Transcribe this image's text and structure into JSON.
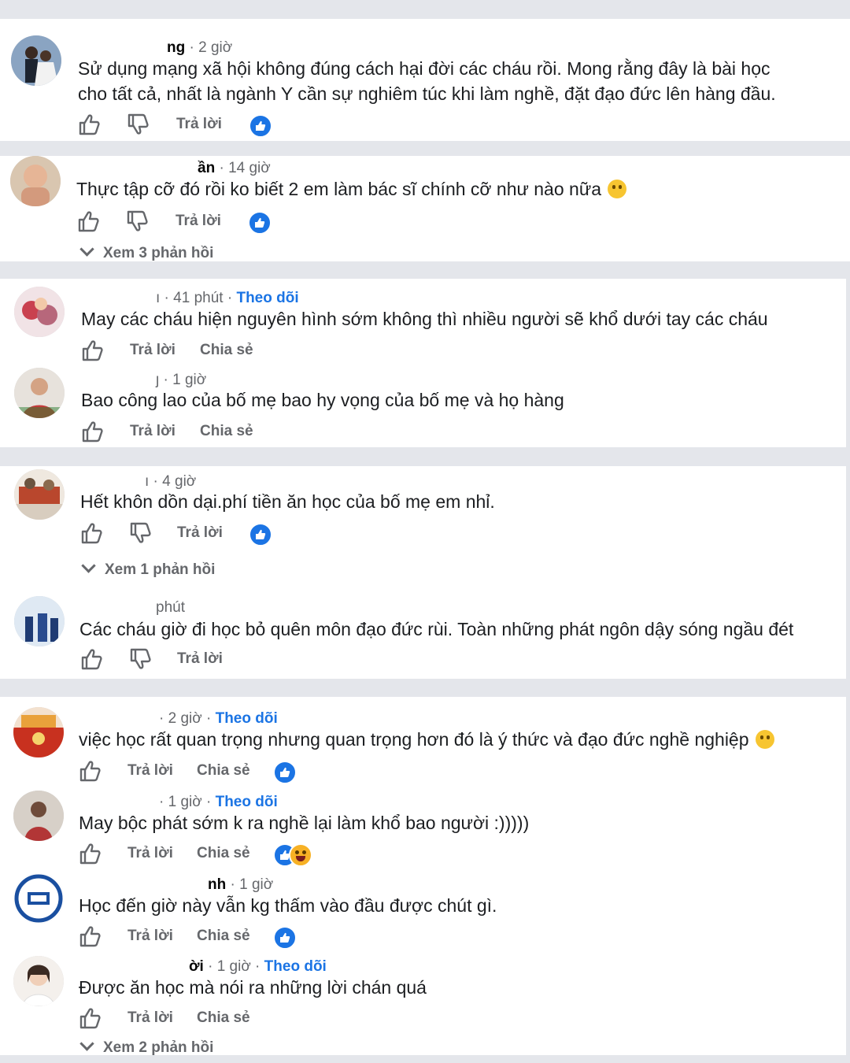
{
  "comments": [
    {
      "name": "ng",
      "time": "2 giờ",
      "follow": "",
      "text": "Sử dụng mạng xã hội không đúng cách hại đời các cháu rồi. Mong rằng đây là bài học cho tất cả, nhất là ngành Y cần sự nghiêm túc khi làm nghề, đặt đạo đức lên hàng đầu.",
      "reply": "Trả lời",
      "share": ""
    },
    {
      "name": "ần",
      "time": "14 giờ",
      "follow": "",
      "text": "Thực tập cỡ đó rồi ko biết 2 em làm bác sĩ chính cỡ như nào nữa",
      "reply": "Trả lời",
      "share": "",
      "more": "Xem 3 phản hồi"
    },
    {
      "name": "",
      "time": "41 phút",
      "follow": "Theo dõi",
      "text": "May các cháu hiện nguyên hình sớm không thì nhiều người sẽ khổ dưới tay các cháu",
      "reply": "Trả lời",
      "share": "Chia sẻ"
    },
    {
      "name": "",
      "time": "1 giờ",
      "follow": "",
      "text": "Bao công lao của bố mẹ bao hy vọng của bố mẹ và họ hàng",
      "reply": "Trả lời",
      "share": "Chia sẻ"
    },
    {
      "name": "",
      "time": "4 giờ",
      "follow": "",
      "text": "Hết khôn dồn dại.phí tiền ăn học của bố mẹ em nhỉ.",
      "reply": "Trả lời",
      "share": "",
      "more": "Xem 1 phản hồi"
    },
    {
      "name": "",
      "time": "phút",
      "follow": "",
      "text": "Các cháu giờ đi học bỏ quên môn đạo đức rùi. Toàn những phát ngôn dậy sóng ngầu đét",
      "reply": "Trả lời",
      "share": ""
    },
    {
      "name": "",
      "time": "2 giờ",
      "follow": "Theo dõi",
      "text": "việc học rất quan trọng nhưng quan trọng hơn đó là ý thức và đạo đức nghề nghiệp",
      "reply": "Trả lời",
      "share": "Chia sẻ"
    },
    {
      "name": "",
      "time": "1 giờ",
      "follow": "Theo dõi",
      "text": "May bộc phát sớm k ra nghề lại làm khổ bao người :)))))",
      "reply": "Trả lời",
      "share": "Chia sẻ"
    },
    {
      "name": "nh",
      "time": "1 giờ",
      "follow": "",
      "text": "Học đến giờ này vẫn kg thấm vào đầu được chút gì.",
      "reply": "Trả lời",
      "share": "Chia sẻ"
    },
    {
      "name": "ời",
      "time": "1 giờ",
      "follow": "Theo dõi",
      "text": "Được ăn học mà nói ra những lời chán quá",
      "reply": "Trả lời",
      "share": "Chia sẻ",
      "more": "Xem 2 phản hồi"
    }
  ],
  "colors": {
    "link": "#1b74e4",
    "muted": "#65676b",
    "background": "#e4e6eb"
  },
  "icons": [
    "like-icon",
    "dislike-icon",
    "like-reaction-icon",
    "haha-reaction-icon",
    "chevron-down-icon"
  ]
}
